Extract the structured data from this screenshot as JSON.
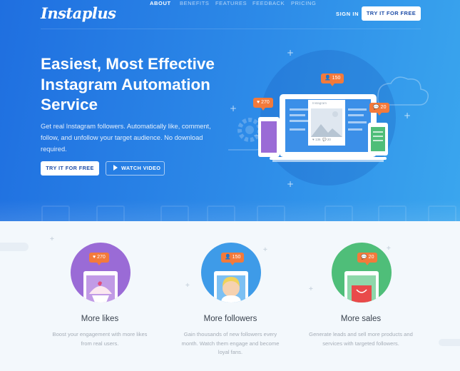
{
  "brand": {
    "logo": "Instaplus"
  },
  "nav": {
    "items": [
      {
        "label": "ABOUT",
        "active": true
      },
      {
        "label": "BENEFITS",
        "active": false
      },
      {
        "label": "FEATURES",
        "active": false
      },
      {
        "label": "FEEDBACK",
        "active": false
      },
      {
        "label": "PRICING",
        "active": false
      }
    ],
    "signin": "SIGN IN",
    "cta": "TRY IT FOR FREE"
  },
  "hero": {
    "headline": "Easiest, Most Effective Instagram Automation Service",
    "subtext": "Get real Instagram followers. Automatically like, comment, follow, and unfollow your target audience. No download required.",
    "primary_button": "TRY IT FOR FREE",
    "secondary_button": "WATCH VIDEO",
    "badges": {
      "likes": "270",
      "followers": "150",
      "comments": "20"
    },
    "post": {
      "label": "Instagram",
      "likes": "136",
      "comments": "20"
    }
  },
  "features": [
    {
      "title": "More likes",
      "desc": "Boost your engagement with more likes from real users.",
      "badge": "270",
      "color": "#9a6bd6"
    },
    {
      "title": "More followers",
      "desc": "Gain thousands of new followers every month. Watch them engage and become loyal fans.",
      "badge": "150",
      "color": "#3e9be8"
    },
    {
      "title": "More sales",
      "desc": "Generate leads and sell more products and services with targeted followers.",
      "badge": "20",
      "color": "#4fbe79"
    }
  ],
  "colors": {
    "hero_start": "#1f6fe0",
    "hero_end": "#3aa6ee",
    "badge": "#f37a3b",
    "cta_text": "#1f4ea8"
  }
}
